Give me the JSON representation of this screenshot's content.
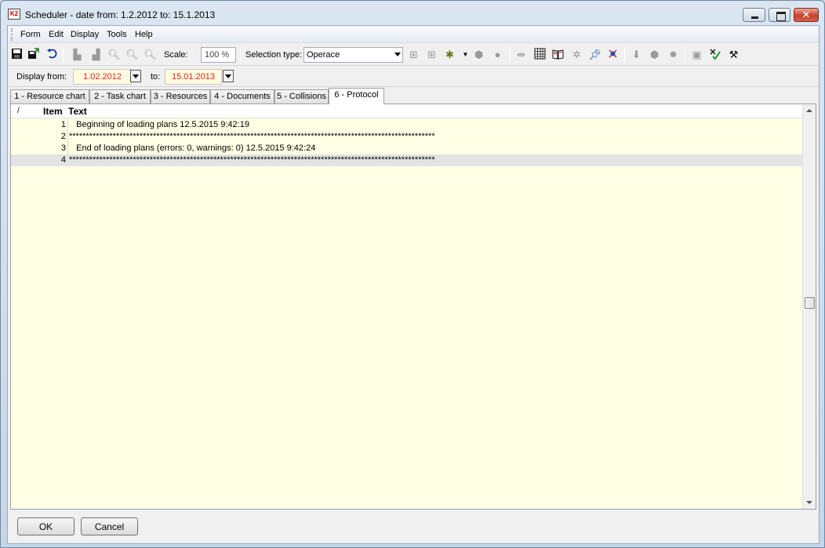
{
  "window": {
    "title": "Scheduler - date from: 1.2.2012 to: 15.1.2013",
    "app_icon_text": "K2"
  },
  "menu": [
    "Form",
    "Edit",
    "Display",
    "Tools",
    "Help"
  ],
  "toolbar": {
    "scale_label": "Scale:",
    "scale_value": "100 %",
    "selection_label": "Selection type:",
    "selection_value": "Operace"
  },
  "datebar": {
    "from_label": "Display from:",
    "from_value": "1.02.2012",
    "to_label": "to:",
    "to_value": "15.01.2013"
  },
  "tabs": [
    "1 - Resource chart",
    "2 - Task chart",
    "3 - Resources",
    "4 - Documents",
    "5 - Collisions",
    "6 - Protocol"
  ],
  "active_tab": "6 - Protocol",
  "grid": {
    "sort_glyph": "/",
    "columns": [
      "Item",
      "Text"
    ],
    "rows": [
      {
        "item": "1",
        "text": "   Beginning of loading plans 12.5.2015 9:42:19"
      },
      {
        "item": "2",
        "text": "*************************************************************************************************************"
      },
      {
        "item": "3",
        "text": "   End of loading plans (errors: 0, warnings: 0) 12.5.2015 9:42:24"
      },
      {
        "item": "4",
        "text": "*************************************************************************************************************"
      }
    ]
  },
  "buttons": {
    "ok": "OK",
    "cancel": "Cancel"
  }
}
